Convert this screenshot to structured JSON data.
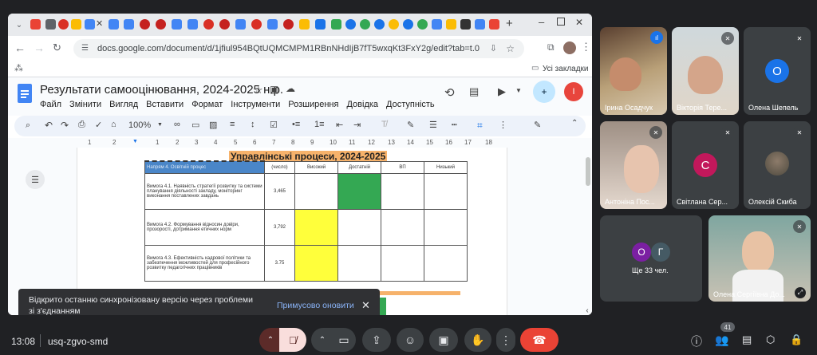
{
  "browser": {
    "url": "docs.google.com/document/d/1jfiul954BQtUQMCMPM1RBnNHdIjB7fT5wxqKt3FxY2g/edit?tab=t.0",
    "bookmarks_label": "Усі закладки"
  },
  "docs": {
    "title": "Результати самооцінювання, 2024-2025 н.р.",
    "menu": [
      "Файл",
      "Змінити",
      "Вигляд",
      "Вставити",
      "Формат",
      "Інструменти",
      "Розширення",
      "Довідка",
      "Доступність"
    ],
    "zoom": "100%",
    "ruler_numbers": [
      "1",
      "2",
      "1",
      "2",
      "3",
      "4",
      "5",
      "6",
      "7",
      "8",
      "9",
      "10",
      "11",
      "12",
      "13",
      "14",
      "15",
      "16",
      "17",
      "18"
    ],
    "section_heading": "Управлінські процеси, 2024-2025",
    "table": {
      "header": [
        "Напрям 4. Освітній процес",
        "(число)",
        "Високий",
        "Достатній",
        "ВП",
        "Низький"
      ],
      "rows": [
        {
          "text": "Вимога 4.1. Наявність стратегії розвитку та системи планування діяльності закладу, моніторинг виконання поставлених завдань",
          "value": "3,465",
          "level": "Достатній"
        },
        {
          "text": "Вимога 4.2. Формування відносин довіри, прозорості, дотримання етичних норм",
          "value": "3,792",
          "level": "Високий"
        },
        {
          "text": "Вимога 4.3. Ефективність кадрової політики та забезпечення можливостей для професійного розвитку педагогічних працівників",
          "value": "3.75",
          "level": "Високий"
        }
      ]
    }
  },
  "toast": {
    "message": "Відкрито останню синхронізовану версію через проблеми зі з'єднанням",
    "action": "Примусово оновити"
  },
  "meet": {
    "participants": [
      {
        "name": "Ірина Осадчук"
      },
      {
        "name": "Вікторія Тере..."
      },
      {
        "name": "Олена Шепель",
        "initial": "О",
        "color": "#1a73e8"
      },
      {
        "name": "Антоніна Пос..."
      },
      {
        "name": "Світлана Сер...",
        "initial": "С",
        "color": "#c2185b"
      },
      {
        "name": "Олексій Скиба"
      },
      {
        "name": "Олена Сергіївна До..."
      }
    ],
    "more": {
      "label": "Ще 33 чел.",
      "initials": [
        "О",
        "Г"
      ]
    },
    "time": "13:08",
    "meeting_code": "usq-zgvo-smd",
    "people_count": "41"
  },
  "colors": {
    "accent": "#1a73e8",
    "end_call": "#ea4335",
    "green_cell": "#34a853",
    "yellow_cell": "#ffff3b",
    "heading_bg": "#f6b26b"
  }
}
